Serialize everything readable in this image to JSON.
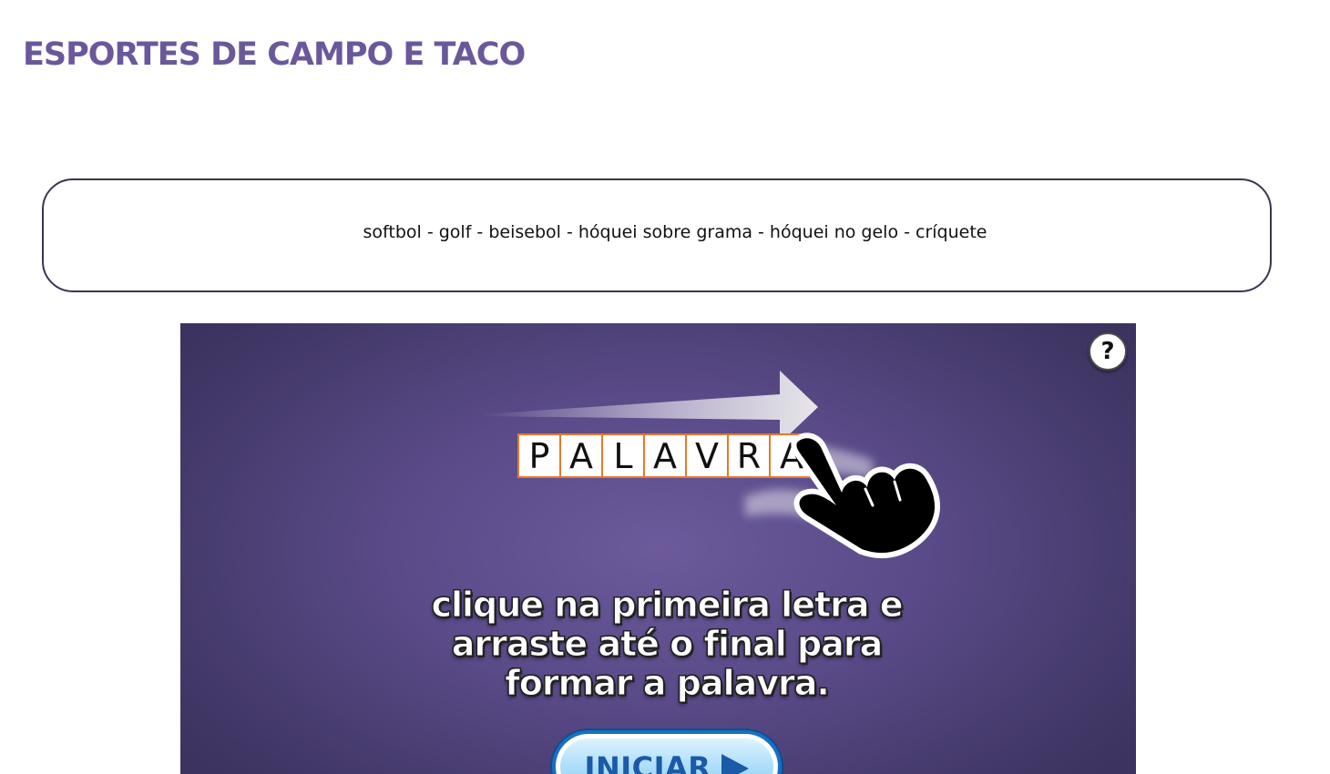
{
  "page": {
    "title": "ESPORTES DE CAMPO E TACO"
  },
  "word_bank": {
    "text": "softbol - golf - beisebol - hóquei sobre grama - hóquei no gelo - críquete"
  },
  "game": {
    "help_label": "?",
    "demo_letters": [
      "P",
      "A",
      "L",
      "A",
      "V",
      "R",
      "A"
    ],
    "instruction_line1": "clique na primeira letra e",
    "instruction_line2": "arraste até o final para",
    "instruction_line3": "formar a palavra.",
    "start_label": "INICIAR",
    "colors": {
      "title": "#6a589b",
      "stage_center": "#6c5a9c",
      "stage_edge": "#3c3360",
      "letter_border": "#e8782a",
      "button_blue": "#1a5aa8"
    },
    "icons": [
      "help-icon",
      "arrow-right-icon",
      "pointing-hand-icon",
      "play-icon"
    ]
  }
}
